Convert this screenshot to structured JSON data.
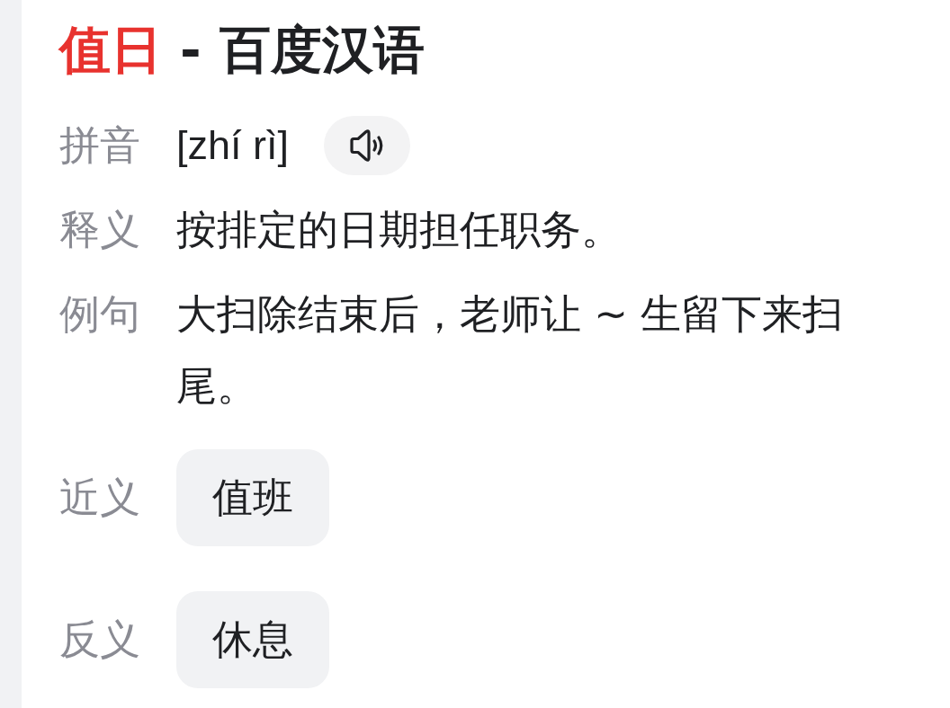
{
  "title": {
    "headword": "值日",
    "suffix": "- 百度汉语"
  },
  "entries": [
    {
      "kind": "pinyin",
      "label": "拼音",
      "value": "[zhí rì]"
    },
    {
      "kind": "text",
      "label": "释义",
      "value": "按排定的日期担任职务。"
    },
    {
      "kind": "text",
      "label": "例句",
      "value": "大扫除结束后，老师让 ~ 生留下来扫尾。"
    },
    {
      "kind": "chips",
      "label": "近义",
      "words": [
        "值班"
      ]
    },
    {
      "kind": "chips",
      "label": "反义",
      "words": [
        "休息"
      ]
    }
  ]
}
